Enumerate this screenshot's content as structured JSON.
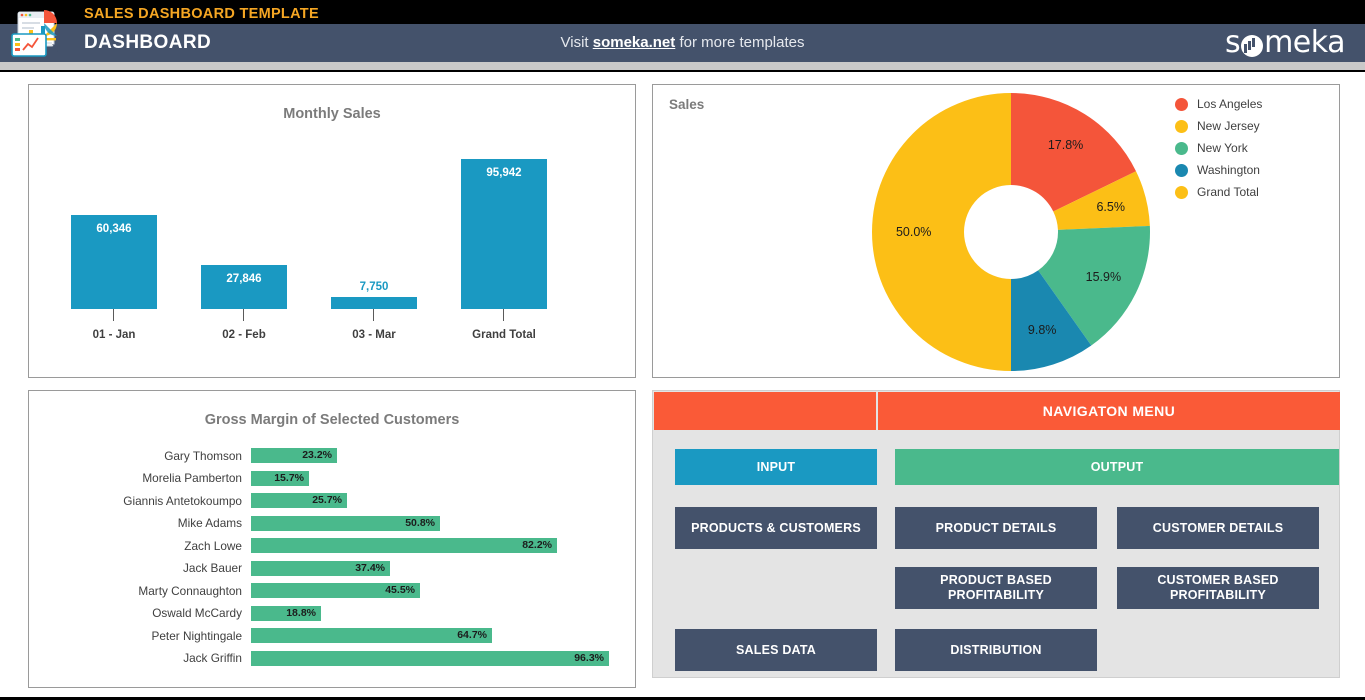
{
  "header": {
    "template_title": "SALES DASHBOARD TEMPLATE",
    "dashboard_title": "DASHBOARD",
    "visit_prefix": "Visit ",
    "visit_link": "someka.net",
    "visit_suffix": " for more templates",
    "brand_left": "s",
    "brand_right": "meka",
    "colors": {
      "black_bar": "#000000",
      "slate_bar": "#44526b",
      "title_orange": "#f5a623"
    }
  },
  "chart_data": [
    {
      "type": "bar",
      "title": "Monthly Sales",
      "categories": [
        "01 - Jan",
        "02 - Feb",
        "03 - Mar",
        "Grand Total"
      ],
      "values": [
        60346,
        27846,
        7750,
        95942
      ],
      "value_labels": [
        "60,346",
        "27,846",
        "7,750",
        "95,942"
      ],
      "xlabel": "",
      "ylabel": "",
      "ylim": [
        0,
        110000
      ],
      "grid": false,
      "legend": "none",
      "series_color": "#1a99c2"
    },
    {
      "type": "pie",
      "title": "Sales",
      "donut": true,
      "legend": "right",
      "labels": [
        "Los Angeles",
        "New Jersey",
        "New York",
        "Washington",
        "Grand Total"
      ],
      "percent_labels": [
        "17.8%",
        "6.5%",
        "15.9%",
        "9.8%",
        "50.0%"
      ],
      "values": [
        17.8,
        6.5,
        15.9,
        9.8,
        50.0
      ],
      "colors": [
        "#f4553a",
        "#fcbf16",
        "#4ab98c",
        "#1a88b0",
        "#fcbf16"
      ]
    },
    {
      "type": "bar",
      "orientation": "horizontal",
      "title": "Gross Margin of Selected Customers",
      "categories": [
        "Gary Thomson",
        "Morelia Pamberton",
        "Giannis Antetokoumpo",
        "Mike Adams",
        "Zach Lowe",
        "Jack Bauer",
        "Marty Connaughton",
        "Oswald McCardy",
        "Peter Nightingale",
        "Jack Griffin"
      ],
      "values": [
        23.2,
        15.7,
        25.7,
        50.8,
        82.2,
        37.4,
        45.5,
        18.8,
        64.7,
        96.3
      ],
      "value_labels": [
        "23.2%",
        "15.7%",
        "25.7%",
        "50.8%",
        "82.2%",
        "37.4%",
        "45.5%",
        "18.8%",
        "64.7%",
        "96.3%"
      ],
      "xlabel": "",
      "ylabel": "",
      "xlim": [
        0,
        100
      ],
      "grid": false,
      "legend": "none",
      "series_color": "#4ab98c"
    }
  ],
  "nav": {
    "header_title": "NAVIGATON MENU",
    "buttons": [
      {
        "label": "INPUT",
        "style": "blue"
      },
      {
        "label": "OUTPUT",
        "style": "green"
      },
      {
        "label": "PRODUCTS & CUSTOMERS",
        "style": "dark"
      },
      {
        "label": "PRODUCT DETAILS",
        "style": "dark"
      },
      {
        "label": "CUSTOMER DETAILS",
        "style": "dark"
      },
      {
        "label": "PRODUCT BASED PROFITABILITY",
        "style": "dark"
      },
      {
        "label": "CUSTOMER BASED PROFITABILITY",
        "style": "dark"
      },
      {
        "label": "SALES DATA",
        "style": "dark"
      },
      {
        "label": "DISTRIBUTION",
        "style": "dark"
      }
    ],
    "colors": {
      "header": "#fa5a37",
      "panel": "#e4e4e4",
      "blue": "#1a99c2",
      "green": "#4ab98c",
      "dark": "#44526b"
    }
  }
}
